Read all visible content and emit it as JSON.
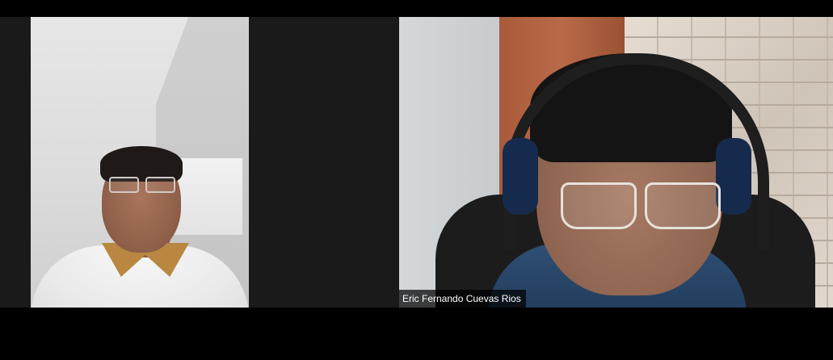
{
  "meeting": {
    "participants": [
      {
        "id": "participant-1",
        "name_label": ""
      },
      {
        "id": "participant-2",
        "name_label": "Eric Fernando Cuevas Rios"
      }
    ]
  },
  "colors": {
    "background": "#000000",
    "tile_letterbox": "#1a1a1a",
    "name_label_bg": "rgba(0,0,0,0.72)",
    "name_label_text": "#ffffff"
  }
}
